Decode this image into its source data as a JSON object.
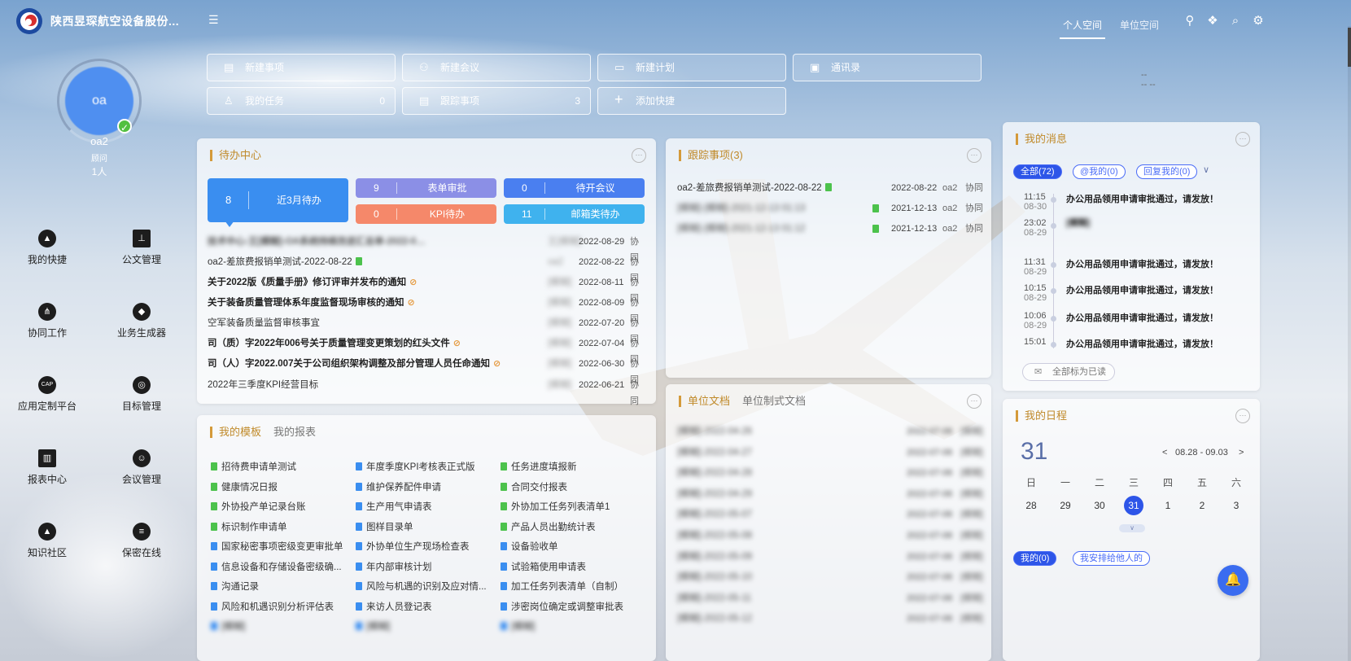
{
  "header": {
    "company": "陕西昱琛航空设备股份...",
    "tabs": [
      "个人空间",
      "单位空间"
    ]
  },
  "user": {
    "name": "oa2",
    "role": "顾问",
    "count": "1人",
    "avatar_text": "oa"
  },
  "sidebar": {
    "items": [
      {
        "label": "我的快捷",
        "icon": "compass-icon"
      },
      {
        "label": "公文管理",
        "icon": "stamp-icon"
      },
      {
        "label": "协同工作",
        "icon": "share-icon"
      },
      {
        "label": "业务生成器",
        "icon": "cube-icon"
      },
      {
        "label": "应用定制平台",
        "icon": "cap-icon"
      },
      {
        "label": "目标管理",
        "icon": "target-icon"
      },
      {
        "label": "报表中心",
        "icon": "chart-icon"
      },
      {
        "label": "会议管理",
        "icon": "people-icon"
      },
      {
        "label": "知识社区",
        "icon": "graduation-icon"
      },
      {
        "label": "保密在线",
        "icon": "list-icon"
      }
    ]
  },
  "quick": {
    "new_item": "新建事项",
    "new_meeting": "新建会议",
    "new_plan": "新建计划",
    "contacts": "通讯录",
    "my_tasks": "我的任务",
    "my_tasks_count": "0",
    "tracking": "跟踪事项",
    "tracking_count": "3",
    "add_shortcut": "添加快捷",
    "side_dash1": "--",
    "side_dash2": "-- --"
  },
  "todo": {
    "title": "待办中心",
    "tiles": {
      "recent_count": "8",
      "recent_label": "近3月待办",
      "form_count": "9",
      "form_label": "表单审批",
      "meeting_count": "0",
      "meeting_label": "待开会议",
      "kpi_count": "0",
      "kpi_label": "KPI待办",
      "mail_count": "11",
      "mail_label": "邮箱类待办"
    },
    "rows": [
      {
        "title": "技术中心-王[模糊]-OA系统持续改进汇总单-2022-08-29",
        "person": "王[模糊]",
        "date": "2022-08-29",
        "cat": "协同"
      },
      {
        "title": "oa2-差旅费报销单测试-2022-08-22",
        "person": "oa2",
        "date": "2022-08-22",
        "cat": "协同"
      },
      {
        "title": "关于2022版《质量手册》修订评审并发布的通知",
        "person": "[模糊]",
        "date": "2022-08-11",
        "cat": "协同"
      },
      {
        "title": "关于装备质量管理体系年度监督现场审核的通知",
        "person": "[模糊]",
        "date": "2022-08-09",
        "cat": "协同"
      },
      {
        "title": "空军装备质量监督审核事宜",
        "person": "[模糊]",
        "date": "2022-07-20",
        "cat": "协同"
      },
      {
        "title": "司（质）字2022年006号关于质量管理变更策划的红头文件",
        "person": "[模糊]",
        "date": "2022-07-04",
        "cat": "协同"
      },
      {
        "title": "司（人）字2022.007关于公司组织架构调整及部分管理人员任命通知",
        "person": "[模糊]",
        "date": "2022-06-30",
        "cat": "协同"
      },
      {
        "title": "2022年三季度KPI经营目标",
        "person": "[模糊]",
        "date": "2022-06-21",
        "cat": "协同"
      }
    ]
  },
  "tracking_panel": {
    "title": "跟踪事项(3)",
    "rows": [
      {
        "title": "oa2-差旅费报销单测试-2022-08-22",
        "date": "2022-08-22",
        "person": "oa2",
        "cat": "协同"
      },
      {
        "title": "[模糊]-[模糊]-2021-12-13 01:13",
        "date": "2021-12-13",
        "person": "oa2",
        "cat": "协同"
      },
      {
        "title": "[模糊]-[模糊]-2021-12-13 01:12",
        "date": "2021-12-13",
        "person": "oa2",
        "cat": "协同"
      }
    ]
  },
  "templates": {
    "tab1": "我的模板",
    "tab2": "我的报表",
    "col1": [
      "招待费申请单测试",
      "健康情况日报",
      "外协投产单记录台账",
      "标识制作申请单",
      "国家秘密事项密级变更审批单",
      "信息设备和存储设备密级确...",
      "沟通记录",
      "风险和机遇识别分析评估表",
      "[模糊]"
    ],
    "col2": [
      "年度季度KPI考核表正式版",
      "维护保养配件申请",
      "生产用气申请表",
      "图样目录单",
      "外协单位生产现场检查表",
      "年内部审核计划",
      "风险与机遇的识别及应对情...",
      "来访人员登记表",
      "[模糊]"
    ],
    "col3": [
      "任务进度填报新",
      "合同交付报表",
      "外协加工任务列表清单1",
      "产品人员出勤统计表",
      "设备验收单",
      "试验箱使用申请表",
      "加工任务列表清单（自制）",
      "涉密岗位确定或调整审批表",
      "[模糊]"
    ]
  },
  "docs": {
    "tab1": "单位文档",
    "tab2": "单位制式文档",
    "rows": [
      "[模糊]-2022-04-26",
      "[模糊]-2022-04-27",
      "[模糊]-2022-04-28",
      "[模糊]-2022-04-29",
      "[模糊]-2022-05-07",
      "[模糊]-2022-05-08",
      "[模糊]-2022-05-09",
      "[模糊]-2022-05-10",
      "[模糊]-2022-05-11",
      "[模糊]-2022-05-12"
    ],
    "dates": "2022-07-06",
    "person": "[模糊]"
  },
  "messages": {
    "title": "我的消息",
    "filters": [
      "全部(72)",
      "@我的(0)",
      "回复我的(0)"
    ],
    "items": [
      {
        "time": "11:15",
        "date": "08-30",
        "text": "办公用品领用申请审批通过，请发放！"
      },
      {
        "time": "23:02",
        "date": "08-29",
        "text": "[模糊]"
      },
      {
        "time": "11:31",
        "date": "08-29",
        "text": "办公用品领用申请审批通过，请发放！"
      },
      {
        "time": "10:15",
        "date": "08-29",
        "text": "办公用品领用申请审批通过，请发放！"
      },
      {
        "time": "10:06",
        "date": "08-29",
        "text": "办公用品领用申请审批通过，请发放！"
      },
      {
        "time": "15:01",
        "date": "",
        "text": "办公用品领用申请审批通过，请发放！"
      }
    ],
    "mark_all": "全部标为已读"
  },
  "schedule": {
    "title": "我的日程",
    "day": "31",
    "range": "08.28 - 09.03",
    "prev": "<",
    "next": ">",
    "weekdays": [
      "日",
      "一",
      "二",
      "三",
      "四",
      "五",
      "六"
    ],
    "days": [
      "28",
      "29",
      "30",
      "31",
      "1",
      "2",
      "3"
    ],
    "today_index": 3,
    "tab_mine": "我的(0)",
    "tab_others": "我安排给他人的"
  }
}
